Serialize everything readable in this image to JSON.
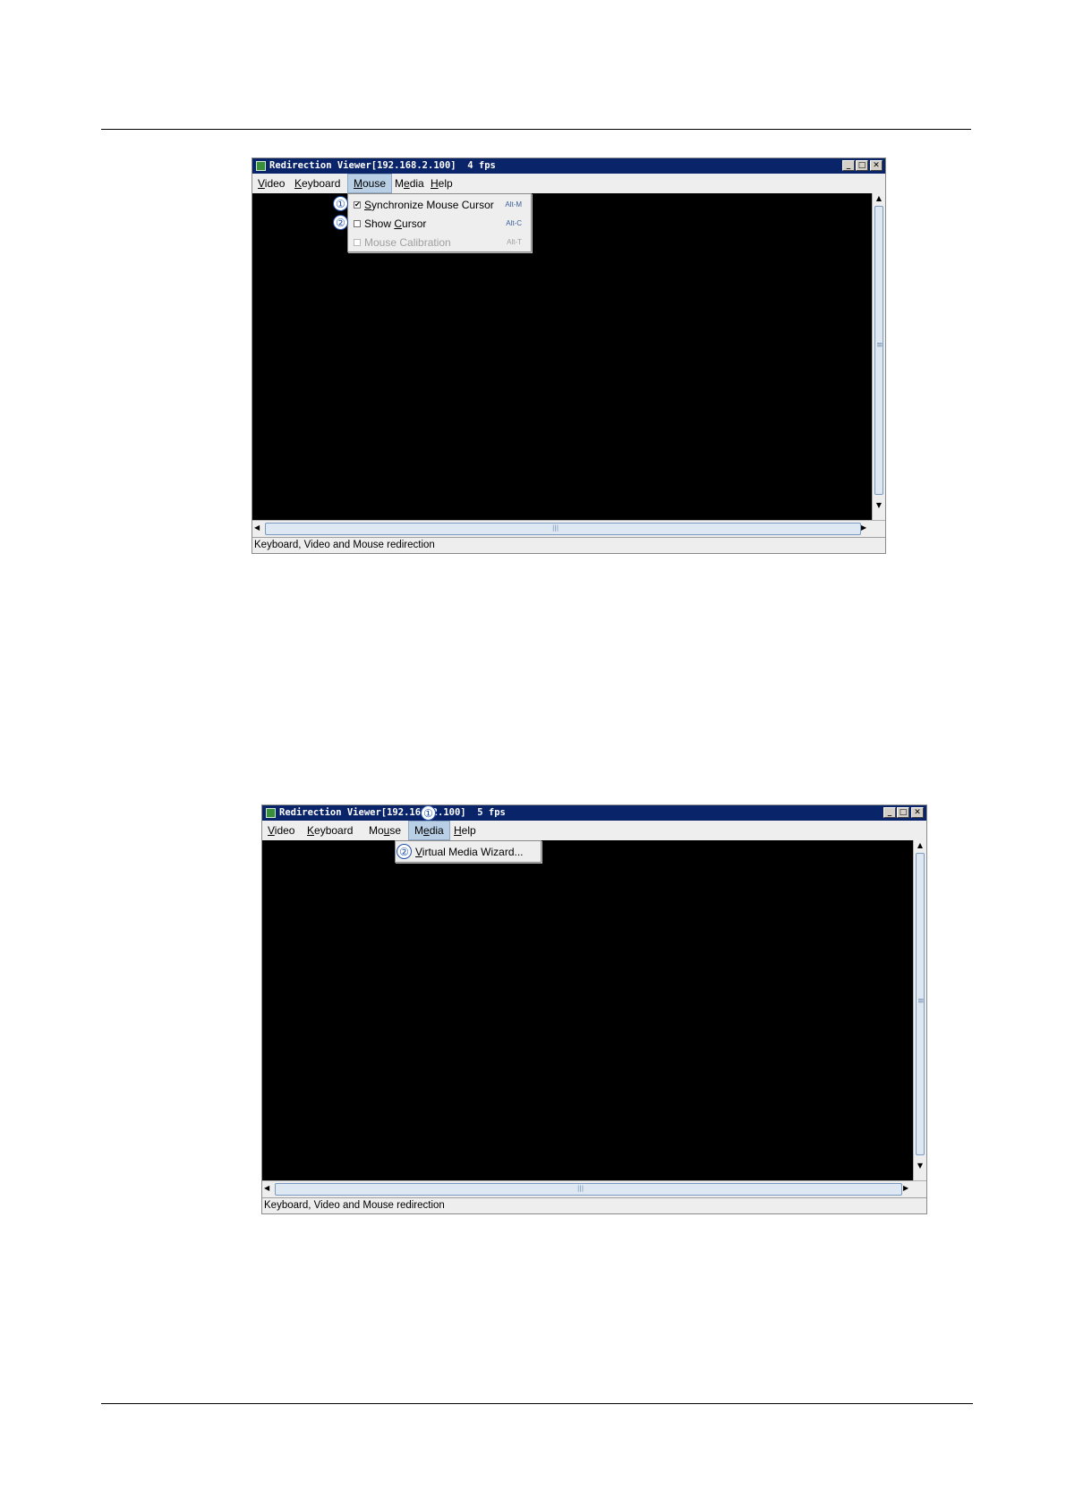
{
  "figure1": {
    "window_title": "Redirection Viewer[192.168.2.100]  4 fps",
    "menus": [
      {
        "mnemonic": "V",
        "rest": "ideo"
      },
      {
        "mnemonic": "K",
        "rest": "eyboard"
      },
      {
        "mnemonic": "M",
        "rest": "ouse"
      },
      {
        "pre": "M",
        "mnemonic": "e",
        "rest": "dia"
      },
      {
        "mnemonic": "H",
        "rest": "elp"
      }
    ],
    "active_menu": "Mouse",
    "mouse_menu_items": [
      {
        "mnemonic": "S",
        "rest": "ynchronize Mouse Cursor",
        "shortcut": "Alt-M",
        "checked": true,
        "enabled": true
      },
      {
        "pre": "Show ",
        "mnemonic": "C",
        "rest": "ursor",
        "shortcut": "Alt-C",
        "checked": false,
        "enabled": true
      },
      {
        "label": "Mouse Calibration",
        "shortcut": "Alt-T",
        "checked": false,
        "enabled": false
      }
    ],
    "callouts": [
      "①",
      "②"
    ],
    "check_mark": "✔",
    "status_text": "Keyboard, Video and Mouse redirection"
  },
  "figure2": {
    "window_title": "Redirection Viewer[192.168.2.100]  5 fps",
    "menus": [
      {
        "mnemonic": "V",
        "rest": "ideo"
      },
      {
        "mnemonic": "K",
        "rest": "eyboard"
      },
      {
        "pre": "Mo",
        "mnemonic": "u",
        "rest": "se"
      },
      {
        "pre": "M",
        "mnemonic": "e",
        "rest": "dia"
      },
      {
        "mnemonic": "H",
        "rest": "elp"
      }
    ],
    "active_menu": "Media",
    "media_menu_items": [
      {
        "mnemonic": "V",
        "rest": "irtual Media Wizard..."
      }
    ],
    "callouts": [
      "①",
      "②"
    ],
    "status_text": "Keyboard, Video and Mouse redirection"
  },
  "window_buttons": {
    "minimize": "_",
    "maximize": "□",
    "close": "✕"
  },
  "scroll_arrows": {
    "up": "▲",
    "down": "▼",
    "left": "◀",
    "right": "▶",
    "grip_v": "≡",
    "grip_h": "|||"
  }
}
